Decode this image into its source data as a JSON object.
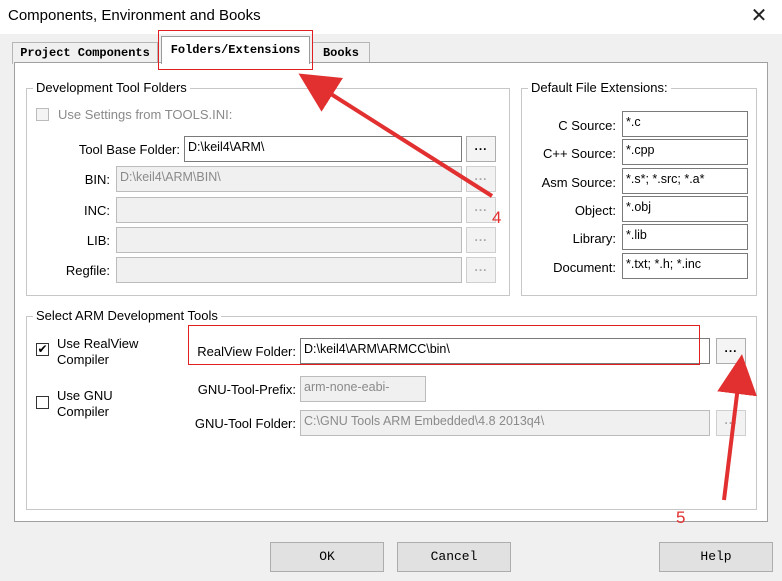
{
  "window": {
    "title": "Components, Environment and Books",
    "close_glyph": "✕"
  },
  "tabs": [
    {
      "label": "Project Components",
      "active": false
    },
    {
      "label": "Folders/Extensions",
      "active": true
    },
    {
      "label": "Books",
      "active": false
    }
  ],
  "dev_tool_folders": {
    "group_title": "Development Tool Folders",
    "use_tools_ini": {
      "label": "Use Settings from TOOLS.INI:",
      "checked": false,
      "enabled": false
    },
    "rows": [
      {
        "label": "Tool Base Folder:",
        "value": "D:\\keil4\\ARM\\",
        "enabled": true
      },
      {
        "label": "BIN:",
        "value": "D:\\keil4\\ARM\\BIN\\",
        "enabled": false
      },
      {
        "label": "INC:",
        "value": "",
        "enabled": false
      },
      {
        "label": "LIB:",
        "value": "",
        "enabled": false
      },
      {
        "label": "Regfile:",
        "value": "",
        "enabled": false
      }
    ],
    "browse_label": "..."
  },
  "default_extensions": {
    "group_title": "Default File Extensions:",
    "rows": [
      {
        "label": "C Source:",
        "value": "*.c"
      },
      {
        "label": "C++ Source:",
        "value": "*.cpp"
      },
      {
        "label": "Asm Source:",
        "value": "*.s*; *.src; *.a*"
      },
      {
        "label": "Object:",
        "value": "*.obj"
      },
      {
        "label": "Library:",
        "value": "*.lib"
      },
      {
        "label": "Document:",
        "value": "*.txt; *.h; *.inc"
      }
    ]
  },
  "arm_tools": {
    "group_title": "Select ARM Development Tools",
    "use_realview": {
      "label_line1": "Use RealView",
      "label_line2": "Compiler",
      "checked": true,
      "check_glyph": "✔"
    },
    "use_gnu": {
      "label_line1": "Use GNU",
      "label_line2": "Compiler",
      "checked": false
    },
    "realview_folder": {
      "label": "RealView Folder:",
      "value": "D:\\keil4\\ARM\\ARMCC\\bin\\"
    },
    "gnu_prefix": {
      "label": "GNU-Tool-Prefix:",
      "value": "arm-none-eabi-"
    },
    "gnu_folder": {
      "label": "GNU-Tool Folder:",
      "value": "C:\\GNU Tools ARM Embedded\\4.8 2013q4\\"
    },
    "browse_label": "..."
  },
  "buttons": {
    "ok": "OK",
    "cancel": "Cancel",
    "help": "Help"
  },
  "annotations": {
    "step4": "4",
    "step5": "5",
    "color": "#e23030"
  }
}
